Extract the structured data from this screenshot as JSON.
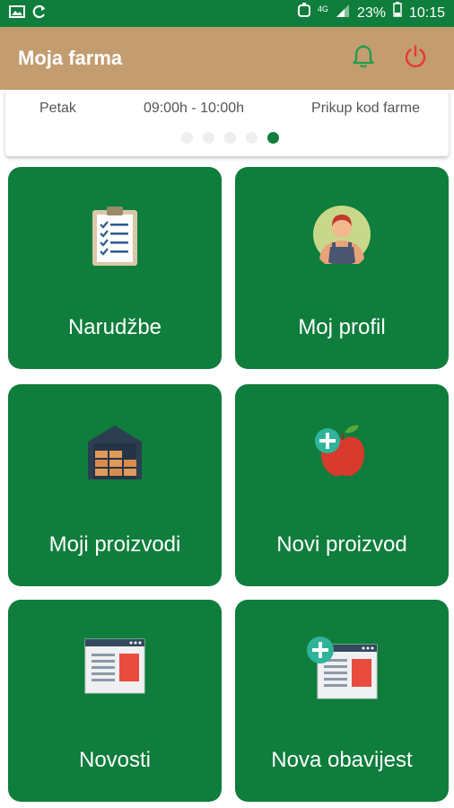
{
  "status_bar": {
    "battery": "23%",
    "time": "10:15",
    "network": "4G"
  },
  "app": {
    "title": "Moja farma"
  },
  "banner": {
    "day": "Petak",
    "time_range": "09:00h - 10:00h",
    "location": "Prikup kod farme",
    "slides": 5,
    "active_slide": 5
  },
  "tiles": [
    {
      "label": "Narudžbe",
      "icon": "clipboard-checklist-icon"
    },
    {
      "label": "Moj profil",
      "icon": "farmer-avatar-icon"
    },
    {
      "label": "Moji proizvodi",
      "icon": "warehouse-icon"
    },
    {
      "label": "Novi proizvod",
      "icon": "apple-plus-icon"
    },
    {
      "label": "Novosti",
      "icon": "news-page-icon"
    },
    {
      "label": "Nova obavijest",
      "icon": "news-plus-icon"
    }
  ],
  "colors": {
    "primary": "#0f7d3c",
    "appbar": "#c39c6f",
    "power": "#e53935",
    "bell": "#1e9e4a"
  }
}
